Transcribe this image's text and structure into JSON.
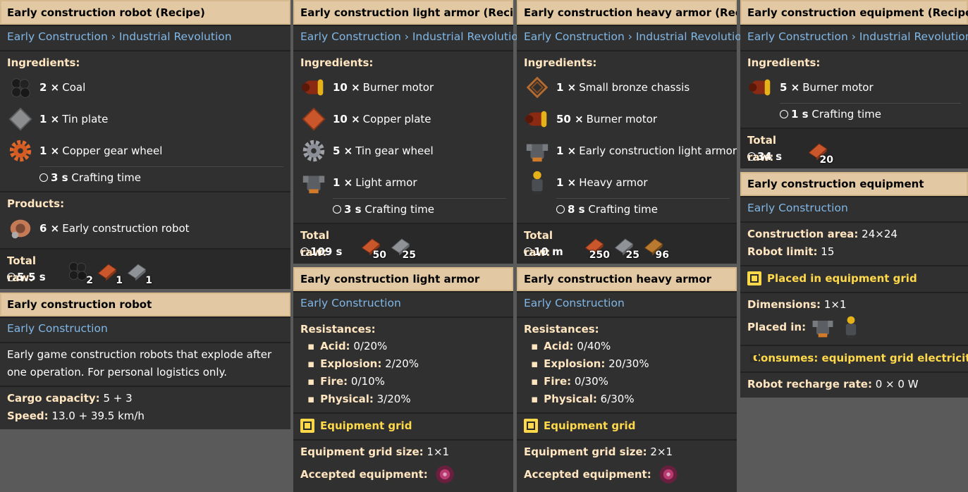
{
  "cards": {
    "robot_recipe": {
      "title": "Early construction robot (Recipe)",
      "tech": "Early Construction",
      "tech2": "Industrial Revolution",
      "ingredients_label": "Ingredients:",
      "ingredients": [
        {
          "count": "2 ×",
          "name": "Coal"
        },
        {
          "count": "1 ×",
          "name": "Tin plate"
        },
        {
          "count": "1 ×",
          "name": "Copper gear wheel"
        }
      ],
      "crafting_time": "3 s",
      "crafting_label": "Crafting time",
      "products_label": "Products:",
      "product": {
        "count": "6 ×",
        "name": "Early construction robot"
      },
      "total_raw_label": "Total raw:",
      "total_time": "5.5 s",
      "raw": [
        "2",
        "1",
        "1"
      ]
    },
    "robot": {
      "title": "Early construction robot",
      "tech": "Early Construction",
      "description": "Early game construction robots that explode after one operation. For personal logistics only.",
      "cargo_label": "Cargo capacity:",
      "cargo_value": "5 + 3",
      "speed_label": "Speed:",
      "speed_value": "13.0 + 39.5  km/h"
    },
    "light_recipe": {
      "title": "Early construction light armor (Recipe)",
      "tech": "Early Construction",
      "tech2": "Industrial Revolution",
      "ingredients_label": "Ingredients:",
      "ingredients": [
        {
          "count": "10 ×",
          "name": "Burner motor"
        },
        {
          "count": "10 ×",
          "name": "Copper plate"
        },
        {
          "count": "5 ×",
          "name": "Tin gear wheel"
        },
        {
          "count": "1 ×",
          "name": "Light armor"
        }
      ],
      "crafting_time": "3 s",
      "crafting_label": "Crafting time",
      "total_raw_label": "Total raw:",
      "total_time": "109 s",
      "raw": [
        "50",
        "25"
      ]
    },
    "light": {
      "title": "Early construction light armor",
      "tech": "Early Construction",
      "resist_label": "Resistances:",
      "resist": [
        {
          "k": "Acid:",
          "v": "0/20%"
        },
        {
          "k": "Explosion:",
          "v": "2/20%"
        },
        {
          "k": "Fire:",
          "v": "0/10%"
        },
        {
          "k": "Physical:",
          "v": "3/20%"
        }
      ],
      "grid_label": "Equipment grid",
      "grid_size_label": "Equipment grid size:",
      "grid_size": "1×1",
      "accepted_label": "Accepted equipment:"
    },
    "heavy_recipe": {
      "title": "Early construction heavy armor (Recipe)",
      "tech": "Early Construction",
      "tech2": "Industrial Revolution",
      "ingredients_label": "Ingredients:",
      "ingredients": [
        {
          "count": "1 ×",
          "name": "Small bronze chassis"
        },
        {
          "count": "50 ×",
          "name": "Burner motor"
        },
        {
          "count": "1 ×",
          "name": "Early construction light armor"
        },
        {
          "count": "1 ×",
          "name": "Heavy armor"
        }
      ],
      "crafting_time": "8 s",
      "crafting_label": "Crafting time",
      "total_raw_label": "Total raw:",
      "total_time": "10 m",
      "raw": [
        "250",
        "25",
        "96"
      ]
    },
    "heavy": {
      "title": "Early construction heavy armor",
      "tech": "Early Construction",
      "resist_label": "Resistances:",
      "resist": [
        {
          "k": "Acid:",
          "v": "0/40%"
        },
        {
          "k": "Explosion:",
          "v": "20/30%"
        },
        {
          "k": "Fire:",
          "v": "0/30%"
        },
        {
          "k": "Physical:",
          "v": "6/30%"
        }
      ],
      "grid_label": "Equipment grid",
      "grid_size_label": "Equipment grid size:",
      "grid_size": "2×1",
      "accepted_label": "Accepted equipment:"
    },
    "equip_recipe": {
      "title": "Early construction equipment (Recipe)",
      "tech": "Early Construction",
      "tech2": "Industrial Revolution",
      "ingredients_label": "Ingredients:",
      "ingredients": [
        {
          "count": "5 ×",
          "name": "Burner motor"
        }
      ],
      "crafting_time": "1 s",
      "crafting_label": "Crafting time",
      "total_raw_label": "Total raw:",
      "total_time": "34 s",
      "raw": [
        "20"
      ]
    },
    "equip": {
      "title": "Early construction equipment",
      "tech": "Early Construction",
      "area_label": "Construction area:",
      "area_value": "24×24",
      "limit_label": "Robot limit:",
      "limit_value": "15",
      "placed_grid_label": "Placed in equipment grid",
      "dims_label": "Dimensions:",
      "dims_value": "1×1",
      "placed_in_label": "Placed in:",
      "consumes_label": "Consumes: equipment grid electricity",
      "recharge_label": "Robot recharge rate:",
      "recharge_value": "0 × 0 W"
    }
  },
  "separator": "›",
  "colors": {
    "title_bg": "#e2c9a3",
    "panel_bg": "#313031",
    "tech_link": "#7fb7e6",
    "label": "#ffe6c0",
    "accent_yellow": "#ffd94a"
  }
}
